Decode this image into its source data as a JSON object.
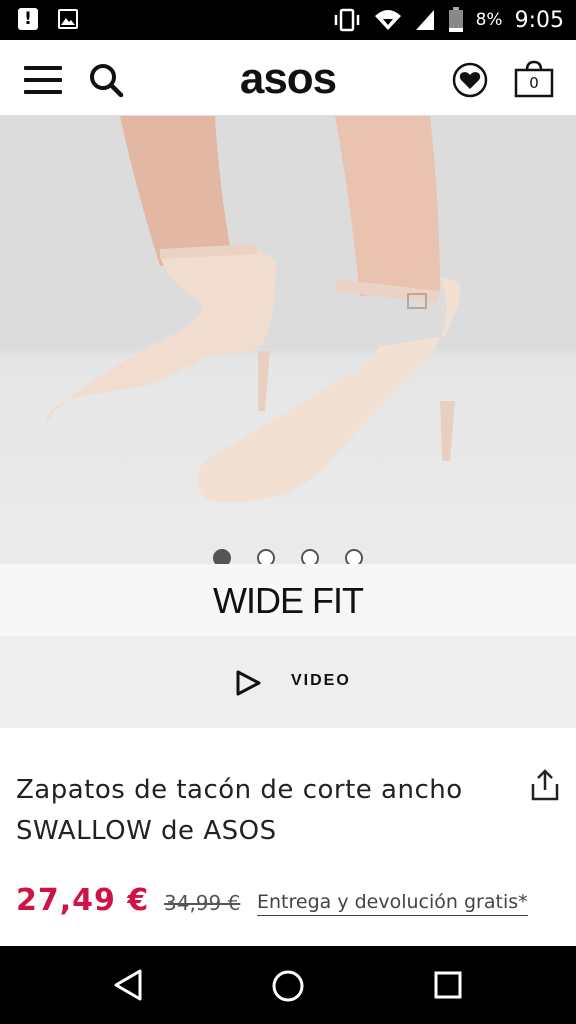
{
  "status_bar": {
    "battery_percent": "8%",
    "time": "9:05",
    "icons": [
      "alert-icon",
      "image-icon",
      "vibrate-icon",
      "wifi-icon",
      "signal-icon",
      "battery-icon"
    ]
  },
  "header": {
    "logo": "asos",
    "bag_count": "0",
    "icons": [
      "menu-icon",
      "search-icon",
      "heart-icon",
      "bag-icon"
    ]
  },
  "gallery": {
    "dot_count": 4,
    "active_index": 0,
    "fit_label": "WIDE FIT"
  },
  "video": {
    "label": "VIDEO"
  },
  "product": {
    "title_line1": "Zapatos de tacón de corte ancho",
    "title_line2": "SWALLOW de ASOS",
    "price": "27,49 €",
    "old_price": "34,99 €",
    "delivery": "Entrega y devolución gratis*"
  },
  "colors": {
    "price": "#d01345",
    "status_bar": "#000000"
  }
}
